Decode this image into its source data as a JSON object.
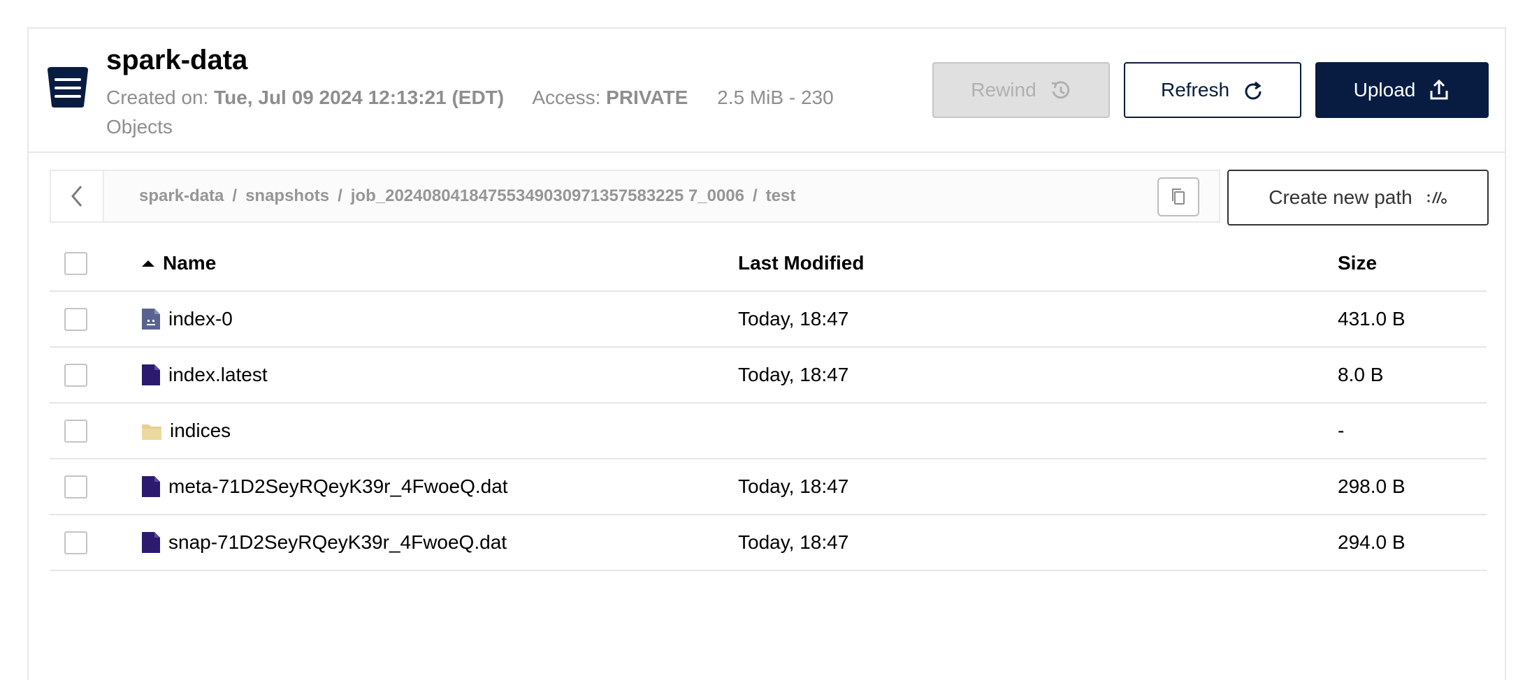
{
  "bucket": {
    "name": "spark-data",
    "created_label": "Created on:",
    "created_value": "Tue, Jul 09 2024 12:13:21 (EDT)",
    "access_label": "Access:",
    "access_value": "PRIVATE",
    "usage": "2.5 MiB - 230 Objects"
  },
  "toolbar": {
    "rewind_label": "Rewind",
    "refresh_label": "Refresh",
    "upload_label": "Upload",
    "new_path_label": "Create new path"
  },
  "breadcrumb": {
    "parts": [
      "spark-data",
      "snapshots",
      "job_20240804184755349030971357583225 7_0006",
      "test"
    ],
    "separator": "/"
  },
  "table": {
    "headers": {
      "name": "Name",
      "modified": "Last Modified",
      "size": "Size"
    },
    "rows": [
      {
        "name": "index-0",
        "modified": "Today, 18:47",
        "size": "431.0 B",
        "icon": "unknown-file-icon"
      },
      {
        "name": "index.latest",
        "modified": "Today, 18:47",
        "size": "8.0 B",
        "icon": "file-icon"
      },
      {
        "name": "indices",
        "modified": "",
        "size": "-",
        "icon": "folder-icon"
      },
      {
        "name": "meta-71D2SeyRQeyK39r_4FwoeQ.dat",
        "modified": "Today, 18:47",
        "size": "298.0 B",
        "icon": "file-icon"
      },
      {
        "name": "snap-71D2SeyRQeyK39r_4FwoeQ.dat",
        "modified": "Today, 18:47",
        "size": "294.0 B",
        "icon": "file-icon"
      }
    ]
  },
  "colors": {
    "brand_navy": "#081c42",
    "file_purple": "#2c1a6e",
    "folder_yellow": "#e5d08f",
    "unknown_file": "#5a6390"
  }
}
